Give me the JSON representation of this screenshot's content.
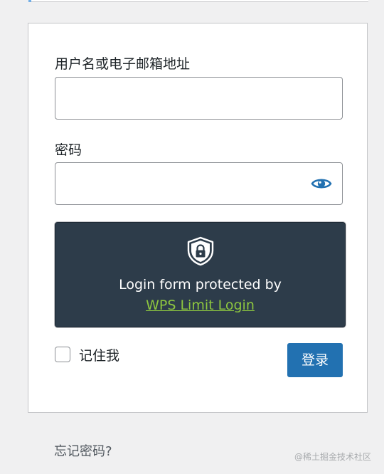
{
  "form": {
    "username_label": "用户名或电子邮箱地址",
    "username_value": "",
    "password_label": "密码",
    "password_value": "",
    "show_password_icon": "eye-icon",
    "protection": {
      "icon": "shield-lock-icon",
      "text": "Login form protected by",
      "link_text": "WPS Limit Login",
      "link_color": "#8dc63f",
      "background": "#2d3c4a"
    },
    "remember_label": "记住我",
    "remember_checked": false,
    "submit_label": "登录",
    "submit_color": "#2271b1"
  },
  "footer": {
    "forgot_password": "忘记密码?",
    "watermark": "@稀土掘金技术社区"
  }
}
